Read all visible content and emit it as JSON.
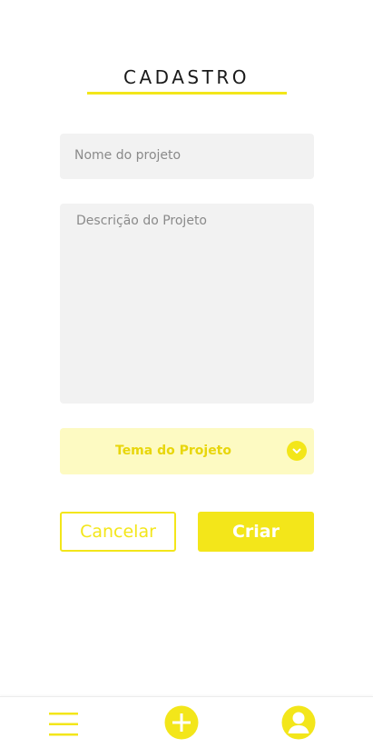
{
  "header": {
    "title": "CADASTRO"
  },
  "form": {
    "name_placeholder": "Nome do projeto",
    "description_placeholder": "Descrição do Projeto",
    "theme_label": "Tema do Projeto"
  },
  "actions": {
    "cancel_label": "Cancelar",
    "create_label": "Criar"
  },
  "bottom_nav": {
    "items": [
      {
        "icon": "menu-icon"
      },
      {
        "icon": "add-icon"
      },
      {
        "icon": "profile-icon"
      }
    ]
  },
  "colors": {
    "accent": "#f3e61a",
    "select_bg": "#fdfac2",
    "field_bg": "#f2f2f2"
  }
}
